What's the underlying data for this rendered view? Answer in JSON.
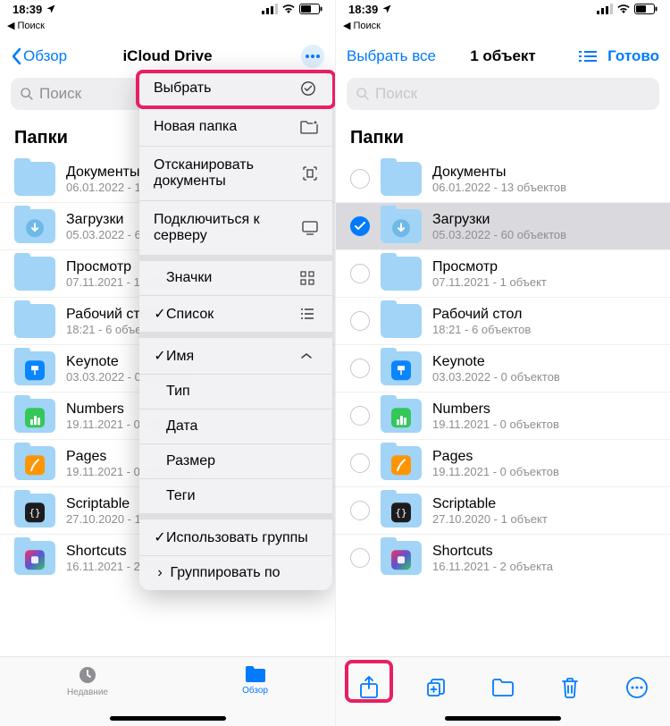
{
  "status": {
    "time": "18:39",
    "back_search": "Поиск"
  },
  "left": {
    "nav": {
      "back": "Обзор",
      "title": "iCloud Drive"
    },
    "search_placeholder": "Поиск",
    "section": "Папки",
    "folders": [
      {
        "name": "Документы",
        "sub": "06.01.2022 - 13 объектов",
        "badge": null
      },
      {
        "name": "Загрузки",
        "sub": "05.03.2022 - 60 объектов",
        "badge": "download"
      },
      {
        "name": "Просмотр",
        "sub": "07.11.2021 - 1 объект",
        "badge": null
      },
      {
        "name": "Рабочий стол",
        "sub": "18:21 - 6 объектов",
        "badge": null
      },
      {
        "name": "Keynote",
        "sub": "03.03.2022 - 0 объектов",
        "badge": "keynote"
      },
      {
        "name": "Numbers",
        "sub": "19.11.2021 - 0 объектов",
        "badge": "numbers"
      },
      {
        "name": "Pages",
        "sub": "19.11.2021 - 0 объектов",
        "badge": "pages"
      },
      {
        "name": "Scriptable",
        "sub": "27.10.2020 - 1 объект",
        "badge": "scriptable"
      },
      {
        "name": "Shortcuts",
        "sub": "16.11.2021 - 2 объекта",
        "badge": "shortcuts"
      }
    ],
    "tabs": {
      "recent": "Недавние",
      "browse": "Обзор"
    },
    "menu": {
      "select": "Выбрать",
      "new_folder": "Новая папка",
      "scan": "Отсканировать документы",
      "connect": "Подключиться к серверу",
      "icons": "Значки",
      "list": "Список",
      "name": "Имя",
      "type": "Тип",
      "date": "Дата",
      "size": "Размер",
      "tags": "Теги",
      "use_groups": "Использовать группы",
      "group_by": "Группировать по"
    }
  },
  "right": {
    "nav": {
      "select_all": "Выбрать все",
      "title": "1 объект",
      "done": "Готово"
    },
    "search_placeholder": "Поиск",
    "section": "Папки",
    "folders": [
      {
        "name": "Документы",
        "sub": "06.01.2022 - 13 объектов",
        "badge": null,
        "checked": false
      },
      {
        "name": "Загрузки",
        "sub": "05.03.2022 - 60 объектов",
        "badge": "download",
        "checked": true
      },
      {
        "name": "Просмотр",
        "sub": "07.11.2021 - 1 объект",
        "badge": null,
        "checked": false
      },
      {
        "name": "Рабочий стол",
        "sub": "18:21 - 6 объектов",
        "badge": null,
        "checked": false
      },
      {
        "name": "Keynote",
        "sub": "03.03.2022 - 0 объектов",
        "badge": "keynote",
        "checked": false
      },
      {
        "name": "Numbers",
        "sub": "19.11.2021 - 0 объектов",
        "badge": "numbers",
        "checked": false
      },
      {
        "name": "Pages",
        "sub": "19.11.2021 - 0 объектов",
        "badge": "pages",
        "checked": false
      },
      {
        "name": "Scriptable",
        "sub": "27.10.2020 - 1 объект",
        "badge": "scriptable",
        "checked": false
      },
      {
        "name": "Shortcuts",
        "sub": "16.11.2021 - 2 объекта",
        "badge": "shortcuts",
        "checked": false
      }
    ]
  }
}
